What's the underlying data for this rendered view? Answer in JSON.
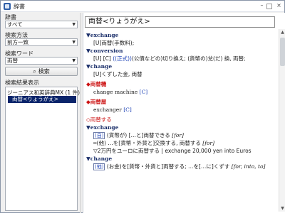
{
  "window": {
    "title": "辞書",
    "min": "–",
    "close": "×"
  },
  "left": {
    "dictionary_label": "辞書",
    "dictionary_value": "すべて",
    "method_label": "検索方法",
    "method_value": "前方一致",
    "word_label": "検索ワード",
    "word_value": "両替",
    "search_button": "検索",
    "results_label": "検索結果表示",
    "results_group": "ジーニアス和英辞典MX (1 件)",
    "results_item": "両替<りょうがえ>"
  },
  "headword": "両替<りょうがえ>",
  "entry": {
    "pos1": "exchange",
    "pos1_sense": "[U]両替(手数料);",
    "pos2": "conversion",
    "pos2_sense_a": "[U] [C]",
    "pos2_sense_b": "((正式))",
    "pos2_sense_c": "(公債などの)切り換え; (貨幣の)兌(だ) 換, 両替;",
    "pos3": "change",
    "pos3_sense": "[U]くずした金, 両替",
    "compound1": "両替機",
    "compound1_en": "change machine",
    "compound1_tag": "[C]",
    "compound2": "両替屋",
    "compound2_en": "exchanger",
    "compound2_tag": "[C]",
    "verb": "◇両替する",
    "v_pos1": "exchange",
    "v1_a_mark": "(自)",
    "v1_a_text": "(貨幣が) […と]両替できる",
    "v1_a_prep": "[for]",
    "v1_b_mark": "━(他)",
    "v1_b_text": "…を[貨幣・外貨と]交換する, 両替する",
    "v1_b_prep": "[for]",
    "v1_example": "▽2万円をユーロに両替する | exchange 20,000 yen into Euros",
    "v_pos2": "change",
    "v2_mark": "(他)",
    "v2_text": "(お金)を[貨幣・外貨と]両替する; …を[…に]くずす",
    "v2_prep": "[for, into, to]"
  }
}
